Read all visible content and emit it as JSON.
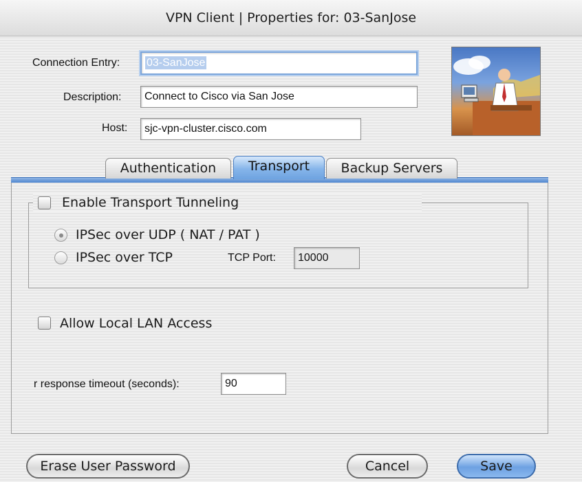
{
  "window": {
    "title": "VPN Client  |  Properties for: 03-SanJose"
  },
  "form": {
    "connection_entry_label": "Connection Entry:",
    "connection_entry_value": "03-SanJose",
    "description_label": "Description:",
    "description_value": "Connect to Cisco via San Jose",
    "host_label": "Host:",
    "host_value": "sjc-vpn-cluster.cisco.com"
  },
  "tabs": [
    {
      "label": "Authentication",
      "active": false
    },
    {
      "label": "Transport",
      "active": true
    },
    {
      "label": "Backup Servers",
      "active": false
    }
  ],
  "transport": {
    "enable_tunneling_label": "Enable Transport Tunneling",
    "enable_tunneling_checked": false,
    "ipsec_udp_label": "IPSec over UDP ( NAT / PAT )",
    "ipsec_tcp_label": "IPSec over TCP",
    "selected_option": "IPSec over UDP ( NAT / PAT )",
    "tcp_port_label": "TCP Port:",
    "tcp_port_value": "10000",
    "allow_lan_label": "Allow Local LAN Access",
    "allow_lan_checked": false,
    "timeout_label": "r response timeout (seconds):",
    "timeout_value": "90"
  },
  "buttons": {
    "erase": "Erase User Password",
    "cancel": "Cancel",
    "save": "Save"
  },
  "icons": {
    "illustration": "vpn-user-illustration-icon"
  },
  "colors": {
    "accent": "#6ea3e0",
    "tab_line": "#4f86cf",
    "selection": "#b5cdee"
  }
}
